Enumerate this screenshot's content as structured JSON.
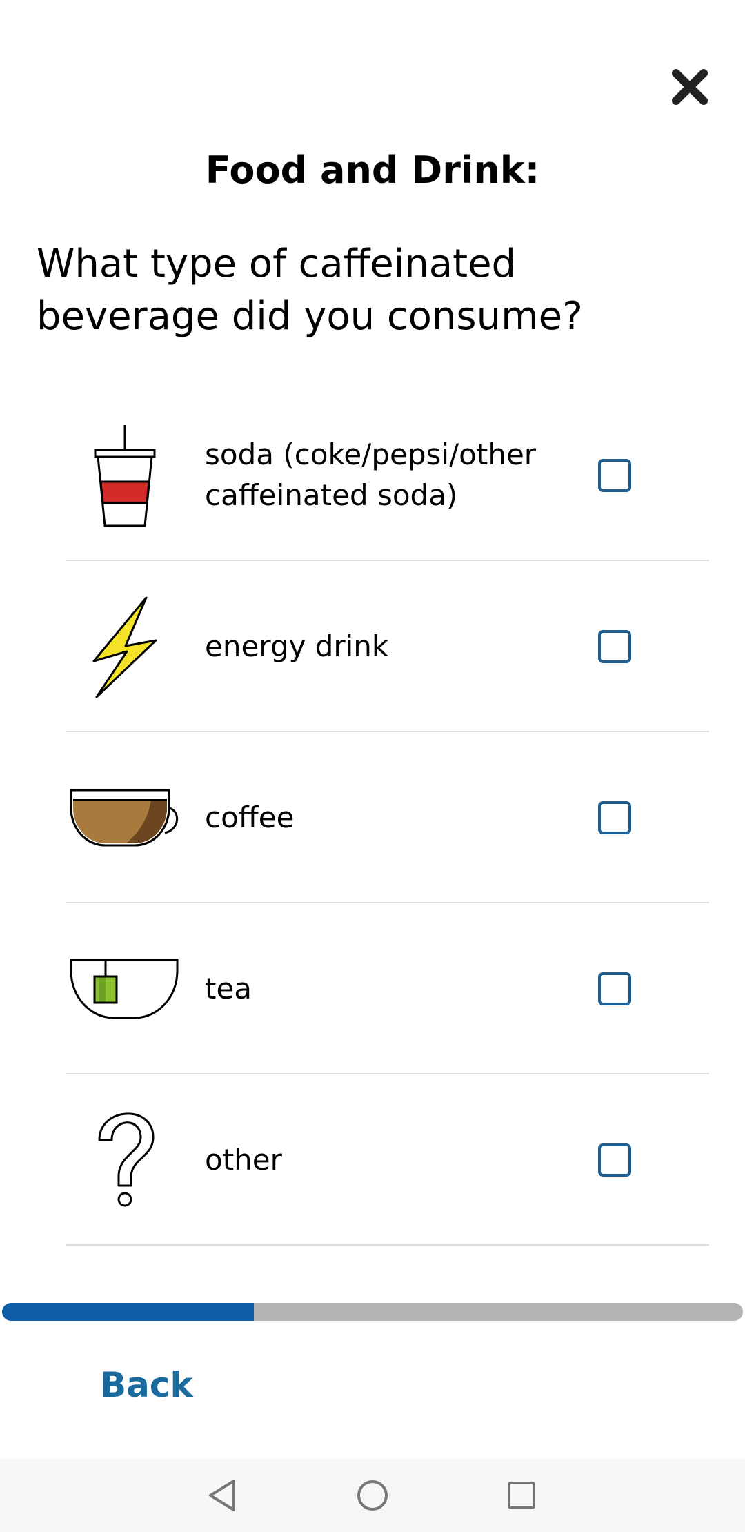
{
  "header": {
    "title": "Food and Drink:",
    "question": "What type of caffeinated beverage did you consume?"
  },
  "options": [
    {
      "label": "soda (coke/pepsi/other caffeinated soda)",
      "icon": "soda-cup-icon",
      "checked": false
    },
    {
      "label": "energy drink",
      "icon": "lightning-bolt-icon",
      "checked": false
    },
    {
      "label": "coffee",
      "icon": "coffee-cup-icon",
      "checked": false
    },
    {
      "label": "tea",
      "icon": "tea-cup-icon",
      "checked": false
    },
    {
      "label": "other",
      "icon": "question-mark-icon",
      "checked": false
    }
  ],
  "progress": {
    "fraction": 0.34
  },
  "footer": {
    "back_label": "Back"
  },
  "colors": {
    "accent": "#1b6a9e",
    "checkbox_border": "#1e5f93",
    "progress_fill": "#0f5da8",
    "progress_track": "#b3b3b3"
  }
}
